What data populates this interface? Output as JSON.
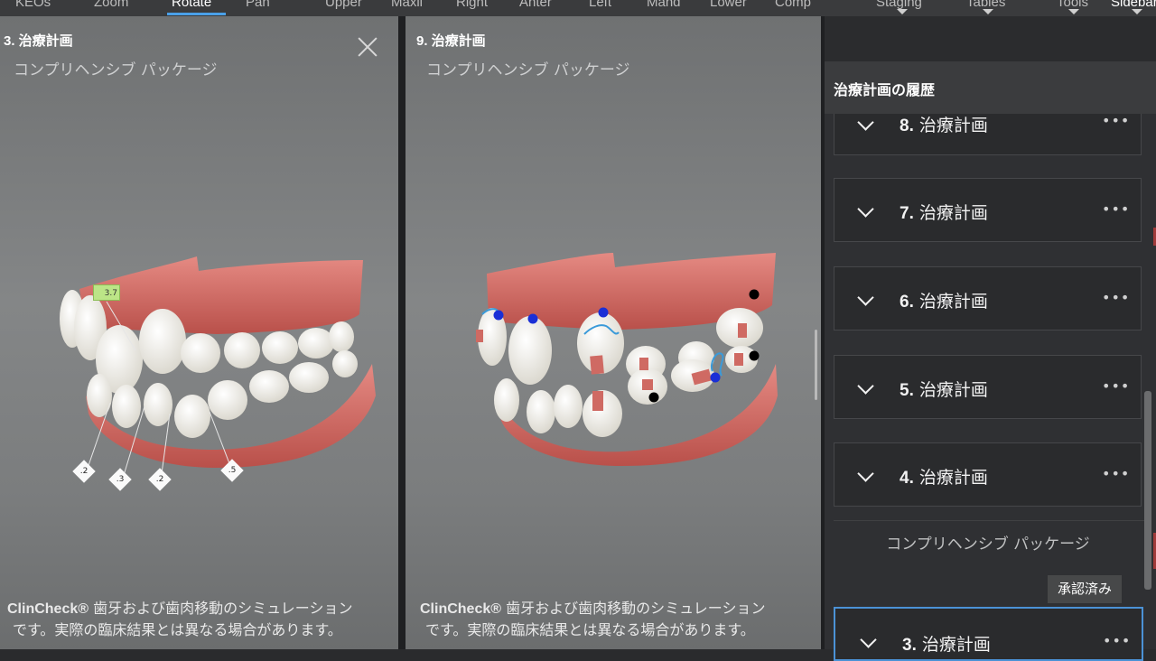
{
  "toolbar": {
    "items": [
      "KEOs",
      "Zoom",
      "Rotate",
      "Pan",
      "Upper",
      "Maxil",
      "Right",
      "Anter",
      "Left",
      "Mand",
      "Lower",
      "Comp",
      "Staging",
      "Tables",
      "Tools",
      "Sidebar"
    ],
    "active": "Rotate"
  },
  "left_panel": {
    "title": "3. 治療計画",
    "subtitle": "コンプリヘンシブ パッケージ",
    "tooth_labels": [
      "3.7",
      ".2",
      ".3",
      ".2",
      ".5"
    ],
    "disclaimer_brand": "ClinCheck®",
    "disclaimer_line1": " 歯牙および歯肉移動のシミュレーション",
    "disclaimer_line2": "です。実際の臨床結果とは異なる場合があります。"
  },
  "right_panel": {
    "title": "9. 治療計画",
    "subtitle": "コンプリヘンシブ パッケージ",
    "disclaimer_brand": "ClinCheck®",
    "disclaimer_line1": " 歯牙および歯肉移動のシミュレーション",
    "disclaimer_line2": "です。実際の臨床結果とは異なる場合があります。"
  },
  "sidebar": {
    "history_title": "治療計画の履歴",
    "plans": [
      {
        "num": "8.",
        "label": "治療計画"
      },
      {
        "num": "7.",
        "label": "治療計画"
      },
      {
        "num": "6.",
        "label": "治療計画"
      },
      {
        "num": "5.",
        "label": "治療計画"
      },
      {
        "num": "4.",
        "label": "治療計画"
      }
    ],
    "package_label": "コンプリヘンシブ パッケージ",
    "approved_badge": "承認済み",
    "selected_plan": {
      "num": "3.",
      "label": "治療計画"
    },
    "more_icon": "ellipsis-icon"
  },
  "colors": {
    "accent": "#4aa0e8",
    "selected_border": "#4b92d6",
    "gum": "#d9736e",
    "tooth": "#f1efe8",
    "attachment": "#cf6a63"
  }
}
